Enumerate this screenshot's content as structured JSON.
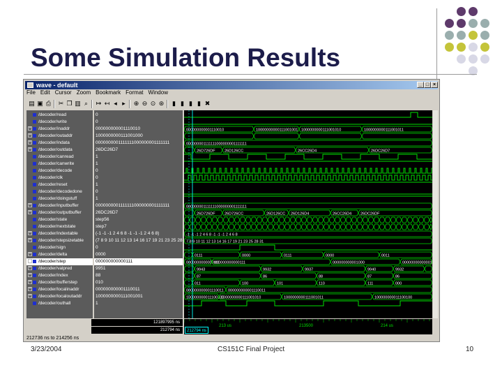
{
  "slide": {
    "title": "Some Simulation Results",
    "footer_date": "3/23/2004",
    "footer_center": "CS151C Final Project",
    "footer_page": "10",
    "dot_colors": [
      "#5e3a6b",
      "#9aaead",
      "#c4c43a",
      "#d8d8e6"
    ]
  },
  "window": {
    "title": "wave - default",
    "menu": [
      "File",
      "Edit",
      "Cursor",
      "Zoom",
      "Bookmark",
      "Format",
      "Window"
    ],
    "toolbar_icons": [
      "open-icon",
      "save-icon",
      "print-icon",
      "cut-icon",
      "copy-icon",
      "paste-icon",
      "find-icon",
      "insert-cursor-icon",
      "delete-cursor-icon",
      "prev-edge-icon",
      "next-edge-icon",
      "zoom-in-icon",
      "zoom-out-icon",
      "zoom-full-icon",
      "zoom-area-icon",
      "run-icon",
      "step-icon",
      "continue-icon",
      "break-icon",
      "stop-icon"
    ],
    "status": "212736 ns to 214256 ns"
  },
  "signals": [
    {
      "name": "/decoder/read",
      "value": "0",
      "expand": false
    },
    {
      "name": "/decoder/write",
      "value": "0",
      "expand": false
    },
    {
      "name": "/decoder/inaddr",
      "value": "000000000001110010",
      "expand": true
    },
    {
      "name": "/decoder/outaddr",
      "value": "1000000000111001000",
      "expand": true
    },
    {
      "name": "/decoder/indata",
      "value": "0000000001111111000000001111111",
      "expand": true
    },
    {
      "name": "/decoder/outdata",
      "value": "26DC26D7",
      "expand": true
    },
    {
      "name": "/decoder/canread",
      "value": "1",
      "expand": false
    },
    {
      "name": "/decoder/canwrite",
      "value": "1",
      "expand": false
    },
    {
      "name": "/decoder/decode",
      "value": "0",
      "expand": false
    },
    {
      "name": "/decoder/clk",
      "value": "0",
      "expand": false
    },
    {
      "name": "/decoder/reset",
      "value": "1",
      "expand": false
    },
    {
      "name": "/decoder/decodedone",
      "value": "0",
      "expand": false
    },
    {
      "name": "/decoder/doingstuff",
      "value": "1",
      "expand": false
    },
    {
      "name": "/decoder/inputbuffer",
      "value": "0000000001111111000000001111111",
      "expand": true
    },
    {
      "name": "/decoder/outputbuffer",
      "value": "26DC26D7",
      "expand": true
    },
    {
      "name": "/decoder/state",
      "value": "step56",
      "expand": false
    },
    {
      "name": "/decoder/nextstate",
      "value": "step7",
      "expand": false
    },
    {
      "name": "/decoder/indextable",
      "value": "(-1 -1 -1 2 4 6 8 -1 -1 -1 2 4 6 8)",
      "expand": true
    },
    {
      "name": "/decoder/stepsizetable",
      "value": "(7 8 9 10 11 12 13 14 16 17 19 21 23 25 28 3",
      "expand": true
    },
    {
      "name": "/decoder/sign",
      "value": "0",
      "expand": false
    },
    {
      "name": "/decoder/delta",
      "value": "0000",
      "expand": true
    },
    {
      "name": "/decoder/step",
      "value": "000000000000111",
      "expand": true,
      "selected": true
    },
    {
      "name": "/decoder/valpred",
      "value": "9951",
      "expand": true
    },
    {
      "name": "/decoder/index",
      "value": "88",
      "expand": true
    },
    {
      "name": "/decoder/bufferstep",
      "value": "010",
      "expand": true
    },
    {
      "name": "/decoder/localinaddr",
      "value": "000000000001110011",
      "expand": true
    },
    {
      "name": "/decoder/localoutaddr",
      "value": "1000000000111001001",
      "expand": true
    },
    {
      "name": "/decoder/outhall",
      "value": "1",
      "expand": false
    }
  ],
  "wave_labels": {
    "inaddr": [
      "000000000001110010",
      "10000000000111001001",
      "1000000000111001010",
      "1000000000111001011"
    ],
    "indata": [
      "000000001111111000000001111111"
    ],
    "outdata": [
      "26DC26D7",
      "26D726DF",
      "26D126CC",
      "26CC26D4"
    ],
    "inputbuffer": [
      "000000001111111000000001111111"
    ],
    "outputbuffer": [
      "26DC26DF",
      "26D726DF",
      "26D726CC",
      "26D126CC",
      "26D126D4",
      "26CC26D4"
    ],
    "indextable": [
      "-1 -1 -1 2 4 6 8 -1 -1 -1 2 4 6 8"
    ],
    "stepsizetable": [
      "7 8 9 10 11 12 13 14 16 17 19 21 23 25 28 31"
    ],
    "delta": [
      "0011",
      "0111",
      "0000",
      "0111",
      "0000"
    ],
    "step": [
      "0000000000000111",
      "000000000000111",
      "000000000001000"
    ],
    "valpred": [
      "9951",
      "9943",
      "9932",
      "9937",
      "9940",
      "9932",
      "9921"
    ],
    "index": [
      "88",
      "87",
      "86",
      "88",
      "87",
      "86"
    ],
    "bufferstep": [
      "010",
      "011",
      "100",
      "101",
      "110",
      "111",
      "000"
    ],
    "localinaddr": [
      "000000000001110011"
    ],
    "localoutaddr": [
      "100000000011100100",
      "1000000000111001010",
      "1000000000111001011"
    ]
  },
  "bottom": {
    "time1": "121897995 ns",
    "time2": "212794 ns",
    "cursor": "212794 ns",
    "ticks": [
      "213 us",
      "213500",
      "214 us"
    ]
  }
}
